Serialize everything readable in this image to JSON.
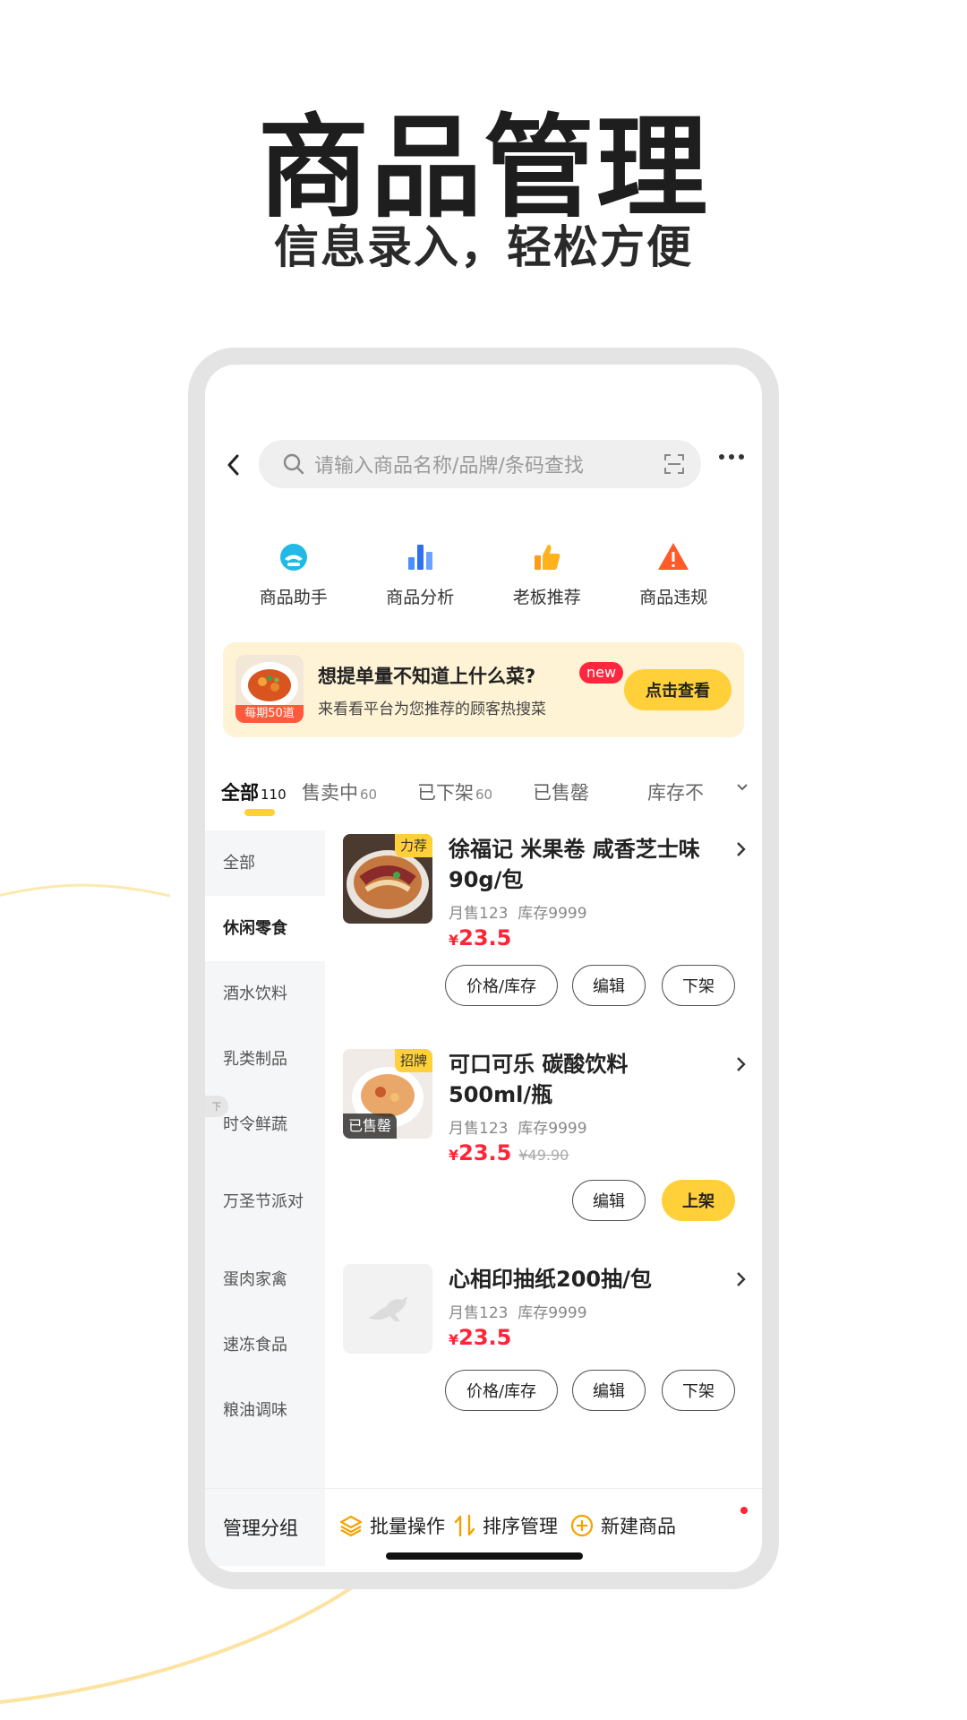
{
  "hero": {
    "title": "商品管理",
    "subtitle": "信息录入，轻松方便"
  },
  "colors": {
    "accent": "#ffd03a",
    "price": "#ff2436",
    "banner_bg": "#fff3d6"
  },
  "search": {
    "placeholder": "请输入商品名称/品牌/条码查找",
    "icon": "search-icon",
    "scan_icon": "scan-icon"
  },
  "quick_menu": [
    {
      "label": "商品助手",
      "icon": "assistant-icon"
    },
    {
      "label": "商品分析",
      "icon": "bar-chart-icon"
    },
    {
      "label": "老板推荐",
      "icon": "thumbs-up-icon"
    },
    {
      "label": "商品违规",
      "icon": "warning-icon"
    }
  ],
  "banner": {
    "thumb_tag": "每期50道",
    "title": "想提单量不知道上什么菜?",
    "badge": "new",
    "desc": "来看看平台为您推荐的顾客热搜菜",
    "button": "点击查看"
  },
  "tabs": [
    {
      "label": "全部",
      "count": "110",
      "active": true
    },
    {
      "label": "售卖中",
      "count": "60"
    },
    {
      "label": "已下架",
      "count": "60"
    },
    {
      "label": "已售罄",
      "count": ""
    },
    {
      "label": "库存不",
      "count": ""
    }
  ],
  "sidebar": {
    "items": [
      "全部",
      "休闲零食",
      "酒水饮料",
      "乳类制品",
      "时令鲜蔬",
      "万圣节派对",
      "蛋肉家禽",
      "速冻食品",
      "粮油调味"
    ],
    "selected": "休闲零食",
    "side_tag": "下"
  },
  "products": [
    {
      "tag": "力荐",
      "name": "徐福记 米果卷 咸香芝士味 90g/包",
      "sales": "月售123",
      "stock": "库存9999",
      "currency": "¥",
      "price": "23.5",
      "old_price": "",
      "soldout": "",
      "buttons": [
        "价格/库存",
        "编辑",
        "下架"
      ]
    },
    {
      "tag": "招牌",
      "name": "可口可乐 碳酸饮料 500ml/瓶",
      "sales": "月售123",
      "stock": "库存9999",
      "currency": "¥",
      "price": "23.5",
      "old_price": "¥49.90",
      "soldout": "已售罄",
      "buttons": [
        "编辑",
        "上架"
      ]
    },
    {
      "tag": "",
      "name": "心相印抽纸200抽/包",
      "sales": "月售123",
      "stock": "库存9999",
      "currency": "¥",
      "price": "23.5",
      "old_price": "",
      "soldout": "",
      "buttons": [
        "价格/库存",
        "编辑",
        "下架"
      ]
    }
  ],
  "bottom_bar": {
    "manage_group": "管理分组",
    "batch": "批量操作",
    "sort": "排序管理",
    "new_product": "新建商品"
  }
}
